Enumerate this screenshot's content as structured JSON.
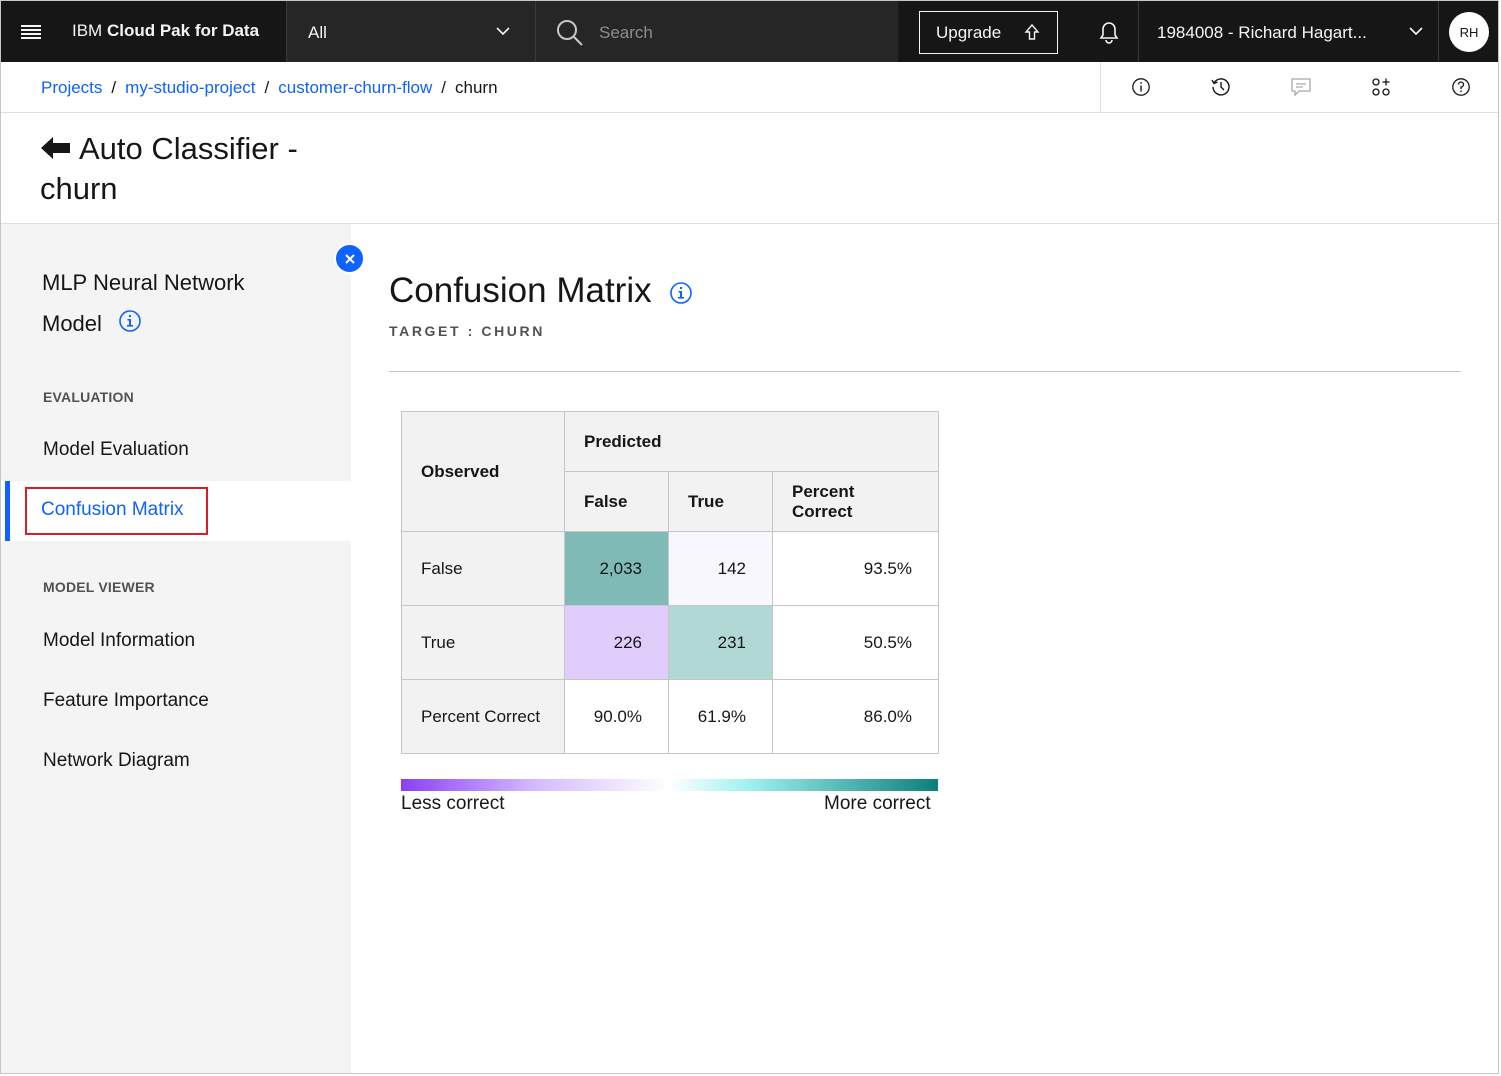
{
  "header": {
    "brand_prefix": "IBM",
    "brand_name": "Cloud Pak for Data",
    "scope": "All",
    "search_placeholder": "Search",
    "upgrade_label": "Upgrade",
    "account": "1984008 - Richard Hagart...",
    "avatar_initials": "RH"
  },
  "breadcrumb": {
    "items": [
      "Projects",
      "my-studio-project",
      "customer-churn-flow"
    ],
    "current": "churn",
    "separator": "/"
  },
  "page": {
    "title": "Auto Classifier - churn"
  },
  "sidebar": {
    "model_title": "MLP Neural Network Model",
    "sections": [
      {
        "heading": "EVALUATION",
        "items": [
          "Model Evaluation",
          "Confusion Matrix"
        ]
      },
      {
        "heading": "MODEL VIEWER",
        "items": [
          "Model Information",
          "Feature Importance",
          "Network Diagram"
        ]
      }
    ],
    "active_item": "Confusion Matrix"
  },
  "main": {
    "title": "Confusion Matrix",
    "target": "TARGET : CHURN",
    "table": {
      "observed_header": "Observed",
      "predicted_header": "Predicted",
      "columns": [
        "False",
        "True",
        "Percent Correct"
      ],
      "rows": [
        {
          "label": "False",
          "values": [
            "2,033",
            "142",
            "93.5%"
          ]
        },
        {
          "label": "True",
          "values": [
            "226",
            "231",
            "50.5%"
          ]
        },
        {
          "label": "Percent Correct",
          "values": [
            "90.0%",
            "61.9%",
            "86.0%"
          ]
        }
      ]
    },
    "legend": {
      "low": "Less correct",
      "high": "More correct"
    }
  },
  "colors": {
    "accent": "#0f62fe",
    "highlight_box": "#da1e28",
    "cell_tp_false": "#7fbab6",
    "cell_fp": "#f8f7fe",
    "cell_fn": "#e0cdfc",
    "cell_tp_true": "#b2d8d6"
  },
  "icons": [
    "menu-icon",
    "chevron-down-icon",
    "search-icon",
    "upload-icon",
    "notification-icon",
    "info-icon",
    "history-icon",
    "comment-icon",
    "apps-icon",
    "help-icon",
    "arrow-left-icon",
    "close-icon"
  ]
}
